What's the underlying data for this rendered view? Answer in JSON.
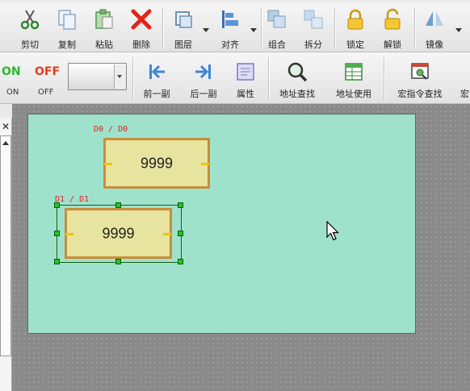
{
  "toolbar_top": {
    "buttons": [
      {
        "label": "剪切",
        "icon": "scissors-icon"
      },
      {
        "label": "复制",
        "icon": "copy-icon"
      },
      {
        "label": "粘贴",
        "icon": "paste-icon"
      },
      {
        "label": "删除",
        "icon": "delete-icon"
      },
      {
        "label": "图层",
        "icon": "layer-icon"
      },
      {
        "label": "对齐",
        "icon": "align-icon"
      },
      {
        "label": "组合",
        "icon": "group-icon"
      },
      {
        "label": "拆分",
        "icon": "ungroup-icon"
      },
      {
        "label": "锁定",
        "icon": "lock-icon"
      },
      {
        "label": "解锁",
        "icon": "unlock-icon"
      },
      {
        "label": "镜像",
        "icon": "mirror-icon"
      }
    ]
  },
  "toolbar_bottom": {
    "on_label": "ON",
    "off_label": "OFF",
    "on_sub": "ON",
    "off_sub": "OFF",
    "buttons": [
      {
        "label": "前一副",
        "icon": "prev-page-icon"
      },
      {
        "label": "后一副",
        "icon": "next-page-icon"
      },
      {
        "label": "属性",
        "icon": "properties-icon"
      },
      {
        "label": "地址查找",
        "icon": "magnifier-icon"
      },
      {
        "label": "地址使用",
        "icon": "table-icon"
      },
      {
        "label": "宏指令查找",
        "icon": "macro-search-icon"
      },
      {
        "label": "宏",
        "icon": "macro-icon"
      }
    ]
  },
  "left_panel": {
    "close": "✕"
  },
  "canvas": {
    "objects": [
      {
        "address": "D0 / D0",
        "value": "9999",
        "selected": false
      },
      {
        "address": "D1 / D1",
        "value": "9999",
        "selected": true
      }
    ]
  },
  "colors": {
    "canvas": "#9fe2cc",
    "object_fill": "#e6e49e",
    "object_border": "#c88d3a",
    "handle": "#27c227",
    "on": "#2db82d",
    "off": "#e53b1e"
  }
}
